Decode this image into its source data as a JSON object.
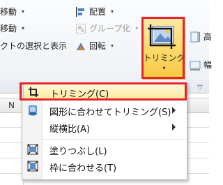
{
  "ribbon": {
    "row1": {
      "move_label": "移動",
      "align_label": "配置",
      "height_label": "高"
    },
    "row2": {
      "move_label": "移動",
      "group_label": "グループ化"
    },
    "row3": {
      "selection_pane_label": "クトの選択と表示",
      "rotate_label": "回転",
      "width_label": "幅"
    },
    "crop": {
      "label": "トリミング"
    },
    "group_label_tail": "サ"
  },
  "sheet": {
    "columns": [
      "N",
      ""
    ]
  },
  "crop_menu": {
    "items": [
      {
        "label": "トリミング(C)",
        "icon": "crop-icon",
        "active": true,
        "submenu": false
      },
      {
        "label": "図形に合わせてトリミング(S)",
        "icon": "crop-to-shape-icon",
        "active": false,
        "submenu": true
      },
      {
        "label": "縦横比(A)",
        "icon": "",
        "active": false,
        "submenu": true
      },
      {
        "label": "塗りつぶし(L)",
        "icon": "fill-icon",
        "active": false,
        "submenu": false
      },
      {
        "label": "枠に合わせる(T)",
        "icon": "fit-icon",
        "active": false,
        "submenu": false
      }
    ]
  },
  "colors": {
    "highlight_red": "#e3262b",
    "ribbon_selected": "#fcd867",
    "menu_active": "#fde9a0"
  }
}
